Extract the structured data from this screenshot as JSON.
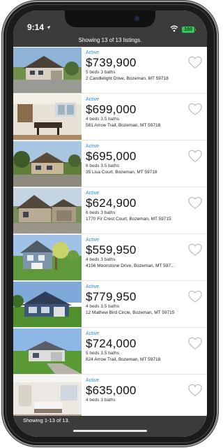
{
  "status_bar": {
    "time": "9:14",
    "battery": "100"
  },
  "header": {
    "showing_text": "Showing 13 of 13 listings."
  },
  "listings": [
    {
      "status": "Active",
      "price": "$739,900",
      "beds": "5 beds 3 baths",
      "address": "2 Candlelight Drive, Bozeman, MT 59718"
    },
    {
      "status": "Active",
      "price": "$699,000",
      "beds": "4 beds 3.5 baths",
      "address": "581 Arrow Trail, Bozeman, MT 59718"
    },
    {
      "status": "Active",
      "price": "$695,000",
      "beds": "6 beds 3.5 baths",
      "address": "35 Lisa Court, Bozeman, MT 59718"
    },
    {
      "status": "Active",
      "price": "$624,900",
      "beds": "6 beds 3 baths",
      "address": "1770 Fir Crest Court, Bozeman, MT 59715"
    },
    {
      "status": "Active",
      "price": "$559,950",
      "beds": "4 beds 3 baths",
      "address": "4156 Moonstone Drive, Bozeman, MT 597..."
    },
    {
      "status": "Active",
      "price": "$779,950",
      "beds": "4 beds 3.5 baths",
      "address": "12 Mathew Bird Circle, Bozeman, MT 59715"
    },
    {
      "status": "Active",
      "price": "$724,000",
      "beds": "5 beds 3.5 baths",
      "address": "824 Arrow Trail, Bozeman, MT 59718"
    },
    {
      "status": "Active",
      "price": "$635,000",
      "beds": "4 beds 3 baths",
      "address": ""
    }
  ],
  "footer": {
    "text": "Showing 1-13 of 13."
  },
  "colors": {
    "bar_background": "#3b3b3b",
    "status_blue": "#2f8bd6",
    "battery_green": "#35c759"
  },
  "icons": [
    "navigation-arrow-icon",
    "wifi-icon",
    "battery-icon",
    "heart-outline-icon"
  ]
}
